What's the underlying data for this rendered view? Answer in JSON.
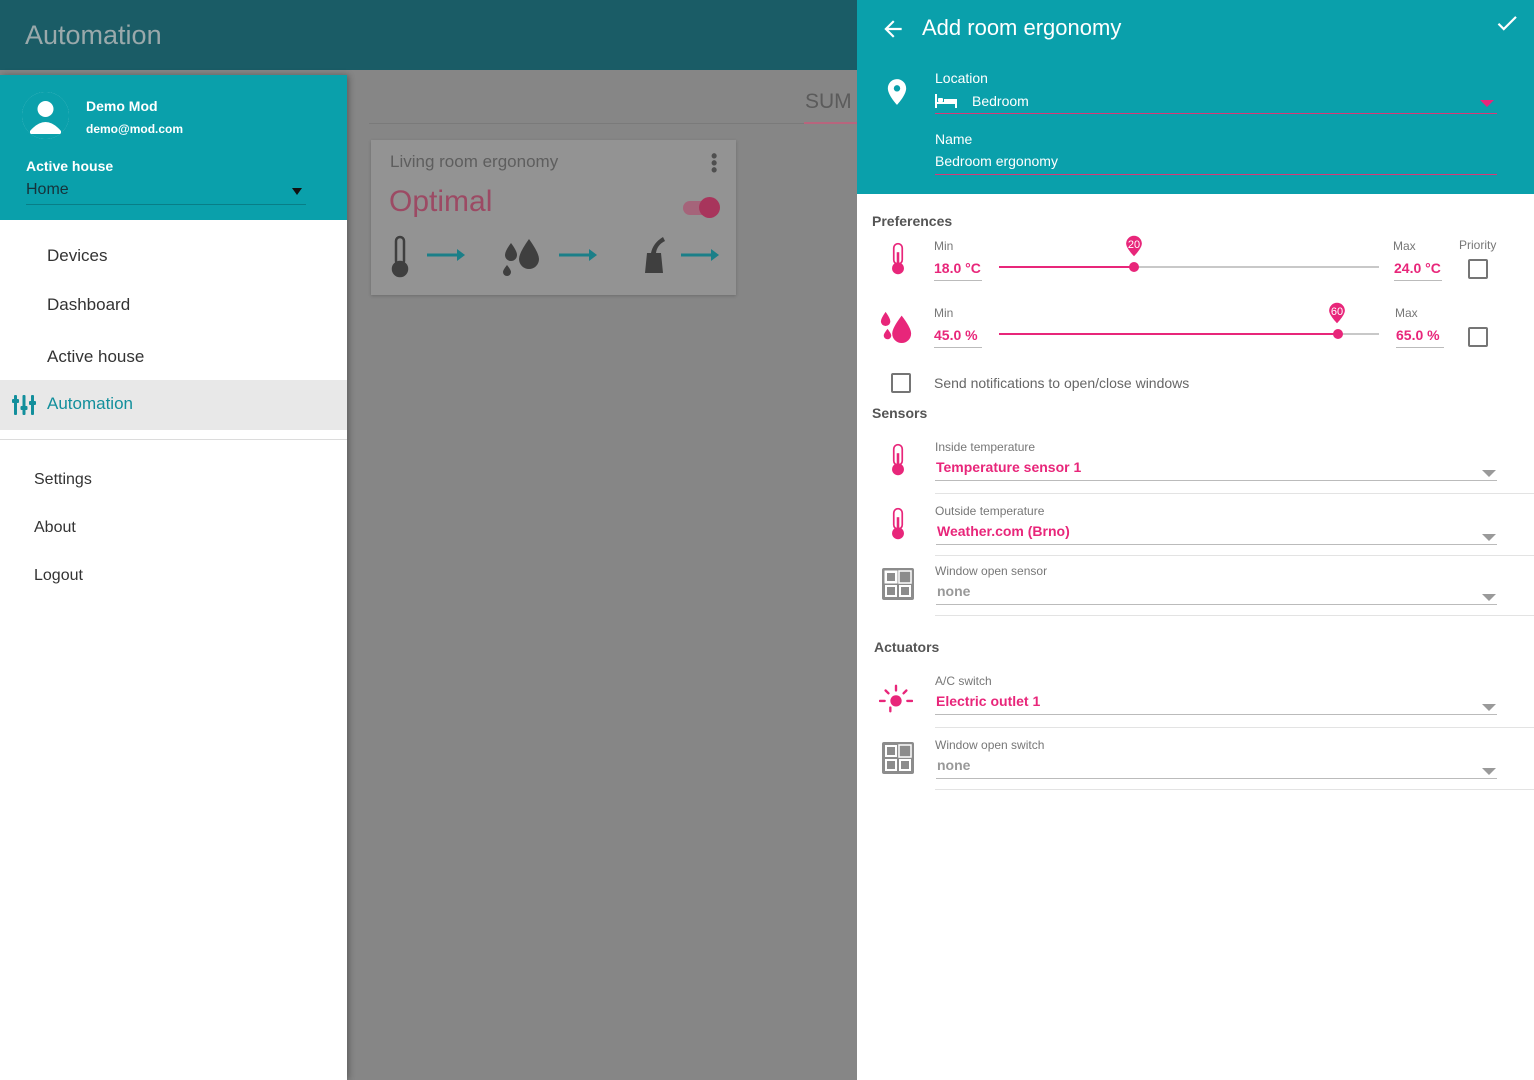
{
  "app": {
    "title": "Automation"
  },
  "background": {
    "tab_label": "SUM",
    "card": {
      "title": "Living room ergonomy",
      "status": "Optimal"
    }
  },
  "drawer": {
    "user": {
      "name": "Demo Mod",
      "email": "demo@mod.com"
    },
    "active_house_label": "Active house",
    "active_house_value": "Home",
    "nav": [
      {
        "label": "Devices"
      },
      {
        "label": "Dashboard"
      },
      {
        "label": "Active house"
      },
      {
        "label": "Automation",
        "active": true
      }
    ],
    "secondary": [
      {
        "label": "Settings"
      },
      {
        "label": "About"
      },
      {
        "label": "Logout"
      }
    ]
  },
  "panel": {
    "title": "Add room ergonomy",
    "location": {
      "label": "Location",
      "value": "Bedroom"
    },
    "name": {
      "label": "Name",
      "value": "Bedroom ergonomy"
    },
    "preferences": {
      "title": "Preferences",
      "min_label": "Min",
      "max_label": "Max",
      "priority_label": "Priority",
      "temperature": {
        "min": "18.0 °C",
        "max": "24.0 °C",
        "slider_value": "20",
        "slider_fraction": 0.36
      },
      "humidity": {
        "min": "45.0 %",
        "max": "65.0 %",
        "slider_value": "60",
        "slider_fraction": 0.89
      },
      "notifications_label": "Send notifications to open/close windows"
    },
    "sensors": {
      "title": "Sensors",
      "items": [
        {
          "label": "Inside temperature",
          "value": "Temperature sensor 1",
          "icon": "thermometer-icon"
        },
        {
          "label": "Outside temperature",
          "value": "Weather.com (Brno)",
          "icon": "thermometer-icon"
        },
        {
          "label": "Window open sensor",
          "value": "none",
          "icon": "window-icon"
        }
      ]
    },
    "actuators": {
      "title": "Actuators",
      "items": [
        {
          "label": "A/C switch",
          "value": "Electric outlet 1",
          "icon": "light-icon"
        },
        {
          "label": "Window open switch",
          "value": "none",
          "icon": "window-icon"
        }
      ]
    }
  },
  "colors": {
    "teal": "#0aa0ab",
    "accent": "#e8267a",
    "dark_topbar": "#1a5c66"
  }
}
